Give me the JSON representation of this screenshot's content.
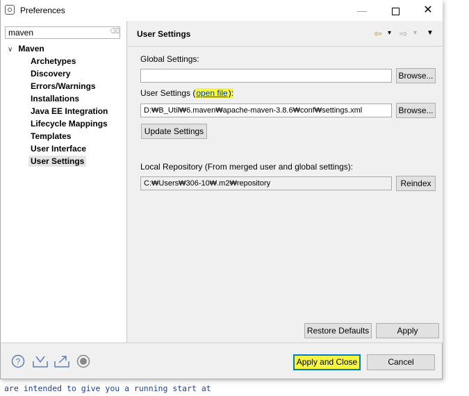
{
  "window": {
    "title": "Preferences"
  },
  "titlebar": {
    "minimize": "—",
    "close": "✕"
  },
  "filter": {
    "value": "maven"
  },
  "tree": {
    "root": "Maven",
    "items": [
      "Archetypes",
      "Discovery",
      "Errors/Warnings",
      "Installations",
      "Java EE Integration",
      "Lifecycle Mappings",
      "Templates",
      "User Interface",
      "User Settings"
    ],
    "selected": "User Settings"
  },
  "page": {
    "title": "User Settings",
    "nav": {
      "back": "⇦",
      "forward": "⇨",
      "dropdown": "▾",
      "menu": "▼"
    },
    "global_settings_label": "Global Settings:",
    "global_settings_value": "",
    "browse1": "Browse...",
    "user_settings_label": "User Settings (",
    "open_file": "open file",
    "user_settings_suffix": "):",
    "user_settings_value": "D:₩B_Util₩6.maven₩apache-maven-3.8.6₩conf₩settings.xml",
    "browse2": "Browse...",
    "update_settings": "Update Settings",
    "local_repo_label": "Local Repository (From merged user and global settings):",
    "local_repo_value": "C:₩Users₩306-10₩.m2₩repository",
    "reindex": "Reindex",
    "restore_defaults": "Restore Defaults",
    "apply": "Apply"
  },
  "footer": {
    "apply_and_close": "Apply and Close",
    "cancel": "Cancel",
    "icons": [
      "help-icon",
      "import-icon",
      "export-icon",
      "record-icon"
    ]
  },
  "console_text": "are intended to give you a running start at",
  "colors": {
    "highlight": "#f5f542",
    "link": "#0645ad",
    "focus": "#0078d7"
  }
}
